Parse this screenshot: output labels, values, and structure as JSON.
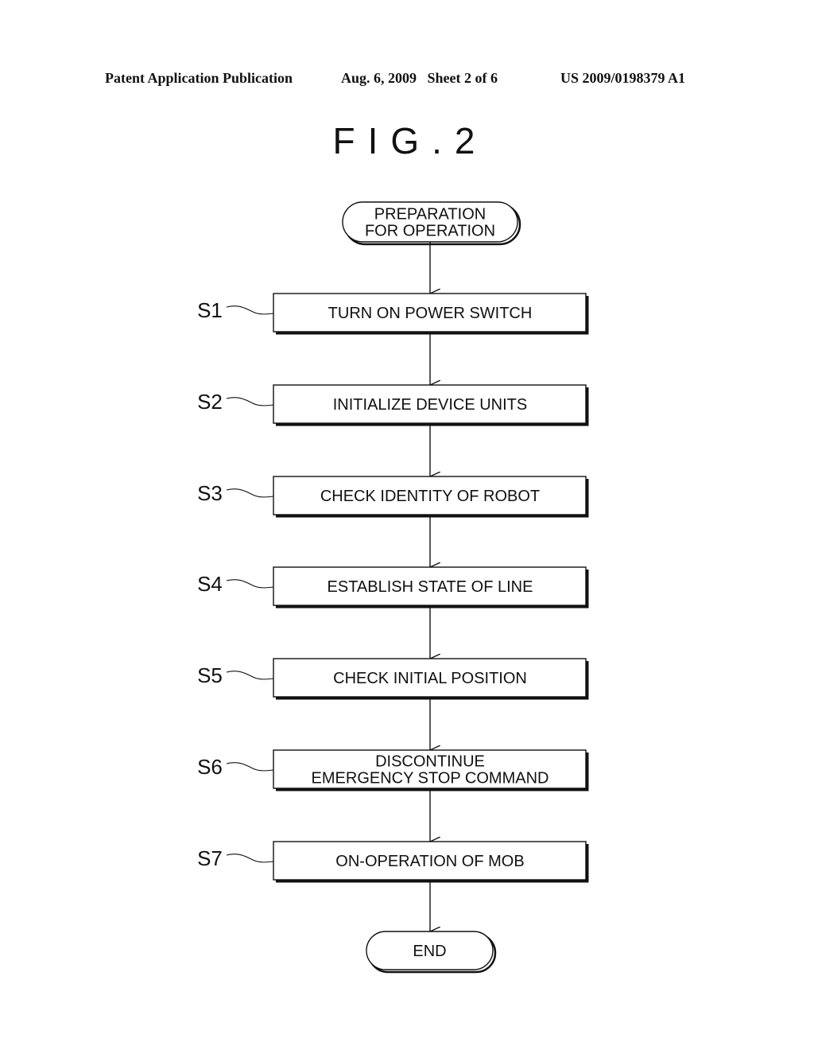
{
  "header": {
    "publication": "Patent Application Publication",
    "date_sheet": "Aug. 6, 2009   Sheet 2 of 6",
    "patent_number": "US 2009/0198379 A1"
  },
  "figure": {
    "title": "FIG.2"
  },
  "flowchart": {
    "start": {
      "lines": [
        "PREPARATION",
        "FOR OPERATION"
      ]
    },
    "steps": [
      {
        "id": "S1",
        "lines": [
          "TURN ON POWER SWITCH"
        ]
      },
      {
        "id": "S2",
        "lines": [
          "INITIALIZE DEVICE UNITS"
        ]
      },
      {
        "id": "S3",
        "lines": [
          "CHECK IDENTITY OF ROBOT"
        ]
      },
      {
        "id": "S4",
        "lines": [
          "ESTABLISH STATE OF LINE"
        ]
      },
      {
        "id": "S5",
        "lines": [
          "CHECK INITIAL POSITION"
        ]
      },
      {
        "id": "S6",
        "lines": [
          "DISCONTINUE",
          "EMERGENCY STOP COMMAND"
        ]
      },
      {
        "id": "S7",
        "lines": [
          "ON-OPERATION OF MOB"
        ]
      }
    ],
    "end": {
      "lines": [
        "END"
      ]
    }
  }
}
